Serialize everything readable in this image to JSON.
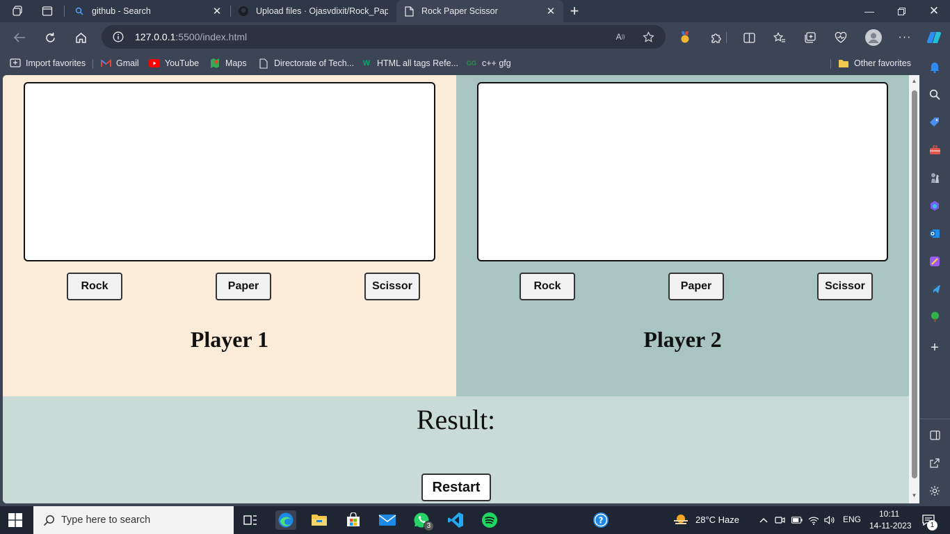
{
  "tabs": [
    {
      "title": "github - Search",
      "active": false
    },
    {
      "title": "Upload files · Ojasvdixit/Rock_Pap",
      "active": false
    },
    {
      "title": "Rock Paper Scissor",
      "active": true
    }
  ],
  "address": {
    "host": "127.0.0.1",
    "path": ":5500/index.html"
  },
  "favorites": [
    {
      "label": "Import favorites",
      "icon": "import-icon"
    },
    {
      "label": "Gmail",
      "icon": "gmail-icon"
    },
    {
      "label": "YouTube",
      "icon": "youtube-icon"
    },
    {
      "label": "Maps",
      "icon": "maps-icon"
    },
    {
      "label": "Directorate of Tech...",
      "icon": "page-icon"
    },
    {
      "label": "HTML  all tags Refe...",
      "icon": "w3-icon"
    },
    {
      "label": "c++ gfg",
      "icon": "gfg-icon"
    }
  ],
  "other_favorites": "Other favorites",
  "game": {
    "player1": {
      "name": "Player 1",
      "buttons": [
        "Rock",
        "Paper",
        "Scissor"
      ]
    },
    "player2": {
      "name": "Player 2",
      "buttons": [
        "Rock",
        "Paper",
        "Scissor"
      ]
    },
    "result_label": "Result:",
    "restart_label": "Restart"
  },
  "taskbar": {
    "search_placeholder": "Type here to search",
    "whatsapp_badge": "3",
    "weather": "28°C  Haze",
    "lang": "ENG",
    "time": "10:11",
    "date": "14-11-2023",
    "notif_count": "1"
  },
  "colors": {
    "player1_bg": "#fbebd9",
    "player2_bg": "#a9c5c1",
    "result_bg": "#c9dbd6",
    "browser_chrome": "#3b4556"
  }
}
